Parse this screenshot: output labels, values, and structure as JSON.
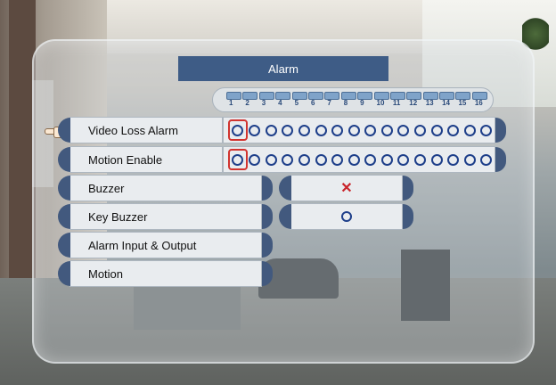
{
  "window": {
    "title": "Alarm"
  },
  "channels": [
    "1",
    "2",
    "3",
    "4",
    "5",
    "6",
    "7",
    "8",
    "9",
    "10",
    "11",
    "12",
    "13",
    "14",
    "15",
    "16"
  ],
  "rows": {
    "video_loss_alarm": {
      "label": "Video Loss Alarm"
    },
    "motion_enable": {
      "label": "Motion Enable"
    },
    "buzzer": {
      "label": "Buzzer",
      "value": "✕"
    },
    "key_buzzer": {
      "label": "Key Buzzer",
      "value": "O"
    },
    "alarm_io": {
      "label": "Alarm Input & Output"
    },
    "motion": {
      "label": "Motion"
    }
  },
  "colors": {
    "title_bg": "#3e5c86",
    "accent": "#1e3f8a",
    "off": "#c9242a"
  }
}
